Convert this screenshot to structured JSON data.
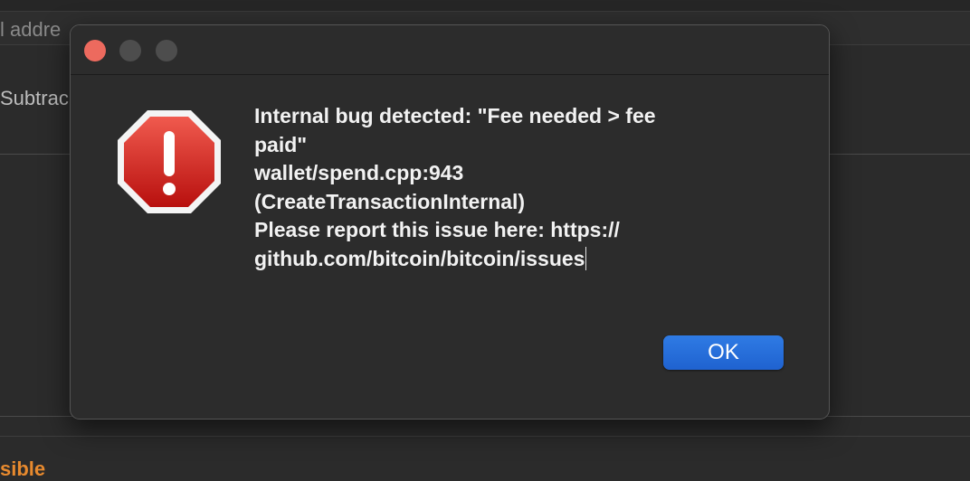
{
  "background": {
    "field_text": "l addre",
    "label": "Subtrac",
    "orange_text": "sible"
  },
  "dialog": {
    "icon": "stop-alert-icon",
    "message_lines": [
      "Internal bug detected: \"Fee needed > fee",
      "paid\"",
      "wallet/spend.cpp:943",
      "(CreateTransactionInternal)",
      "Please report this issue here: https://",
      "github.com/bitcoin/bitcoin/issues"
    ],
    "ok_label": "OK"
  },
  "colors": {
    "accent": "#2a6fdb",
    "close": "#ed6a5e",
    "alert_red": "#d9231f",
    "background_orange": "#e88a2e"
  }
}
